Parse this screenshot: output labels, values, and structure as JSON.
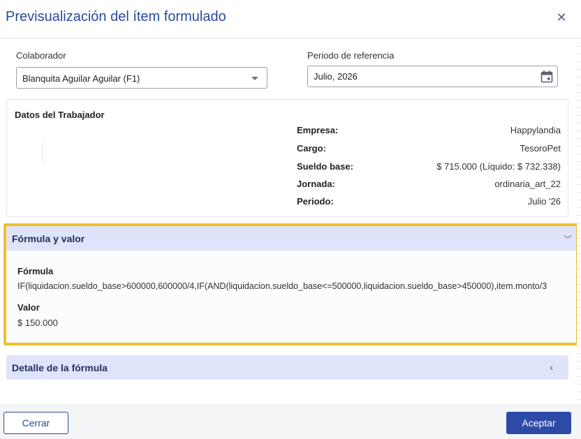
{
  "dialog": {
    "title": "Previsualización del ítem formulado",
    "close_icon": "close-icon"
  },
  "collaborator": {
    "label": "Colaborador",
    "selected": "Blanquita Aguilar Aguilar (F1)"
  },
  "period": {
    "label": "Periodo de referencia",
    "value": "Julio, 2026",
    "icon": "calendar-icon"
  },
  "worker": {
    "title": "Datos del Trabajador",
    "rows": [
      {
        "label": "Empresa:",
        "value": "Happylandia"
      },
      {
        "label": "Cargo:",
        "value": "TesoroPet"
      },
      {
        "label": "Sueldo base:",
        "value": "$ 715.000 (Líquido: $ 732.338)"
      },
      {
        "label": "Jornada:",
        "value": "ordinaria_art_22"
      },
      {
        "label": "Periodo:",
        "value": "Julio '26"
      }
    ]
  },
  "formula_section": {
    "title": "Fórmula y valor",
    "formula_label": "Fórmula",
    "formula": "IF(liquidacion.sueldo_base>600000,600000/4,IF(AND(liquidacion.sueldo_base<=500000,liquidacion.sueldo_base>450000),item.monto/3",
    "value_label": "Valor",
    "value": "$ 150.000",
    "highlight_color": "#f0c02a"
  },
  "detail_section": {
    "title": "Detalle de la fórmula"
  },
  "footer": {
    "cancel_label": "Cerrar",
    "accept_label": "Aceptar",
    "accent_color": "#2c4aa6"
  }
}
